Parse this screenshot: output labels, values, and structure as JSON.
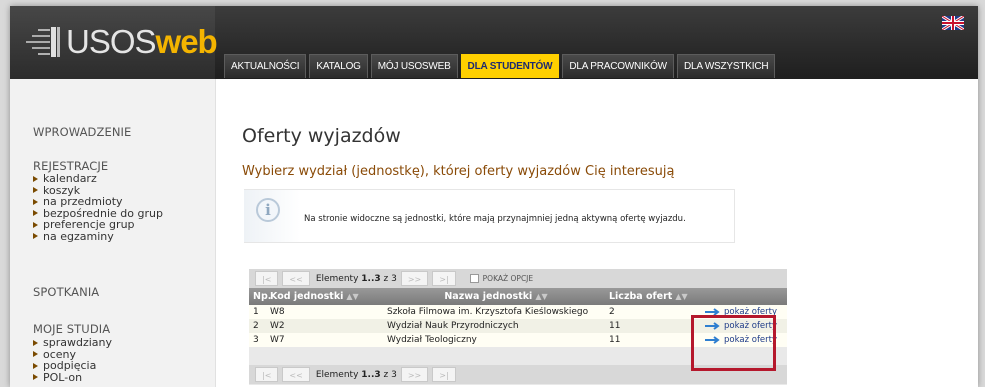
{
  "header": {
    "logo_part1": "USOS",
    "logo_part2": "web",
    "tabs": [
      {
        "label": "AKTUALNOŚCI",
        "active": false
      },
      {
        "label": "KATALOG",
        "active": false
      },
      {
        "label": "MÓJ USOSWEB",
        "active": false
      },
      {
        "label": "DLA STUDENTÓW",
        "active": true
      },
      {
        "label": "DLA PRACOWNIKÓW",
        "active": false
      },
      {
        "label": "DLA WSZYSTKICH",
        "active": false
      }
    ],
    "language_icon": "uk-flag-icon"
  },
  "sidebar": {
    "sections": [
      {
        "title": "WPROWADZENIE",
        "items": []
      },
      {
        "title": "REJESTRACJE",
        "items": [
          "kalendarz",
          "koszyk",
          "na przedmioty",
          "bezpośrednie do grup",
          "preferencje grup",
          "na egzaminy"
        ]
      },
      {
        "title": "SPOTKANIA",
        "items": []
      },
      {
        "title": "MOJE STUDIA",
        "items": [
          "sprawdziany",
          "oceny",
          "podpięcia",
          "POL-on"
        ]
      }
    ]
  },
  "main": {
    "title": "Oferty wyjazdów",
    "subtitle": "Wybierz wydział (jednostkę), której oferty wyjazdów Cię interesują",
    "info_text": "Na stronie widoczne są jednostki, które mają przynajmniej jedną aktywną ofertę wyjazdu.",
    "info_icon": "info-icon"
  },
  "table": {
    "pager": {
      "first": "|<",
      "prev": "<<",
      "next": ">>",
      "last": ">|",
      "count_prefix": "Elementy",
      "count_range": "1..3",
      "count_of": "z 3",
      "options_label": "POKAŻ OPCJE"
    },
    "headers": [
      "Np.",
      "Kod jednostki",
      "Nazwa jednostki",
      "Liczba ofert",
      ""
    ],
    "sort_icons": {
      "kod": "▲▼",
      "nazwa": "▲▼",
      "liczba": "▲▼"
    },
    "rows": [
      {
        "np": "1",
        "kod": "W8",
        "nazwa": "Szkoła Filmowa im. Krzysztofa Kieślowskiego",
        "liczba": "2",
        "link": "pokaż oferty"
      },
      {
        "np": "2",
        "kod": "W2",
        "nazwa": "Wydział Nauk Przyrodniczych",
        "liczba": "11",
        "link": "pokaż oferty"
      },
      {
        "np": "3",
        "kod": "W7",
        "nazwa": "Wydział Teologiczny",
        "liczba": "11",
        "link": "pokaż oferty"
      }
    ]
  },
  "colors": {
    "active_tab": "#ffd000",
    "subtitle": "#8a4b08",
    "link": "#1f3c88",
    "highlight": "#b5182c"
  }
}
